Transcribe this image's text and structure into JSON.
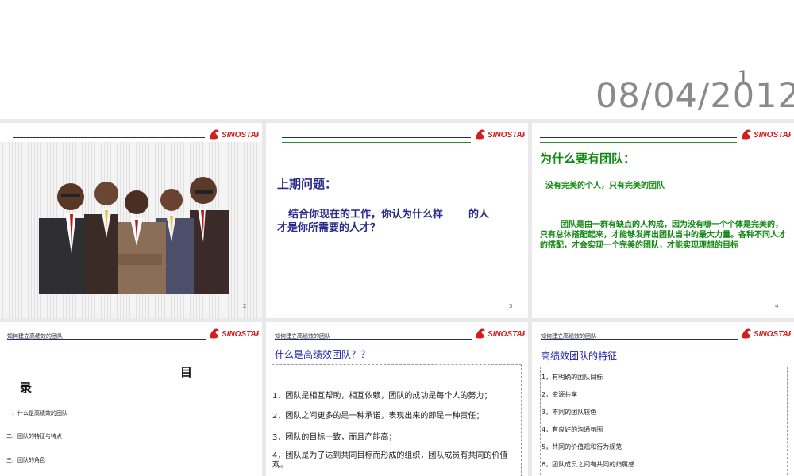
{
  "title_slide": {
    "page_number": "1",
    "date": "08/04/2012"
  },
  "logo": {
    "text": "SINOSTAR",
    "color": "#d21e1e"
  },
  "colors": {
    "navy": "#2a2a8a",
    "green": "#118811",
    "blue_title": "#2222aa"
  },
  "slides": [
    {
      "page": "2",
      "image": "five-businessmen-illustration"
    },
    {
      "page": "3",
      "title": "上期问题：",
      "body_1": "结合你现在的工作，你认为什么样",
      "body_2": "的人",
      "body_3": "才是你所需要的人才？"
    },
    {
      "page": "4",
      "title": "为什么要有团队：",
      "subtitle": "没有完美的个人，只有完美的团队",
      "body": "团队是由一群有缺点的人构成，因为没有哪一个个体是完美的，只有总体搭配起来，才能够发挥出团队当中的最大力量。各种不同人才的搭配，才会实现一个完美的团队，才能实现理想的目标"
    },
    {
      "header": "知何建立高绩效的团队",
      "toc_title_1": "目",
      "toc_title_2": "录",
      "items": [
        "一、什么是高绩效的团队",
        "二、团队的特征与特点",
        "三、团队的角色"
      ]
    },
    {
      "header": "知何建立高绩效的团队",
      "title": "什么是高绩效团队？？",
      "items": [
        "1，团队是相互帮助，相互依赖，团队的成功是每个人的努力；",
        "2，团队之间更多的是一种承诺，表现出来的即是一种责任；",
        "3，团队的目标一致，而且产能高；",
        "4，团队是为了达到共同目标而形成的组织，团队成员有共同的价值观。"
      ]
    },
    {
      "header": "知何建立高绩效的团队",
      "title": "高绩效团队的特征",
      "items": [
        "1，有明确的团队目标",
        "2，资源共享",
        "3，不同的团队较色",
        "4，有良好的沟通氛围",
        "5，共同的价值观和行为规范",
        "6，团队成员之间有共同的归属感"
      ]
    }
  ]
}
